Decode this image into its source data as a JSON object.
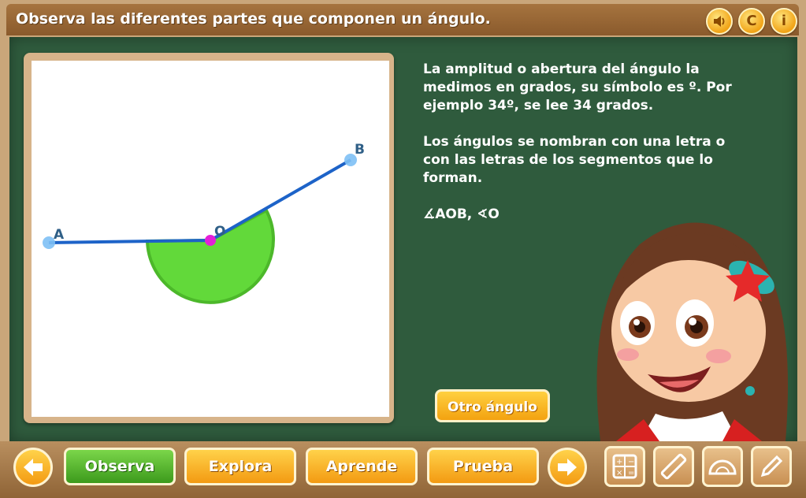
{
  "header": {
    "title": "Observa las diferentes partes que componen un ángulo.",
    "buttons": [
      {
        "name": "sound",
        "label": ""
      },
      {
        "name": "credits",
        "label": "C"
      },
      {
        "name": "info",
        "label": "i"
      }
    ]
  },
  "diagram": {
    "points": {
      "A": "A",
      "O": "O",
      "B": "B"
    }
  },
  "explanation": {
    "paragraph1": "La amplitud o abertura del ángulo la medimos en grados, su símbolo es º. Por ejemplo 34º, se lee 34 grados.",
    "paragraph2": "Los ángulos se nombran con una  letra o con las letras de los segmentos que lo forman.",
    "notation": "∡AOB,   ∢O"
  },
  "actions": {
    "other_angle": "Otro ángulo"
  },
  "nav": {
    "observa": "Observa",
    "explora": "Explora",
    "aprende": "Aprende",
    "prueba": "Prueba"
  },
  "colors": {
    "board": "#2f5b3d",
    "wood": "#a6743f",
    "accent_orange": "#f39a12",
    "active_green": "#3c9a1c",
    "angle_fill": "#62d93a",
    "ray_blue": "#1d63c8"
  }
}
